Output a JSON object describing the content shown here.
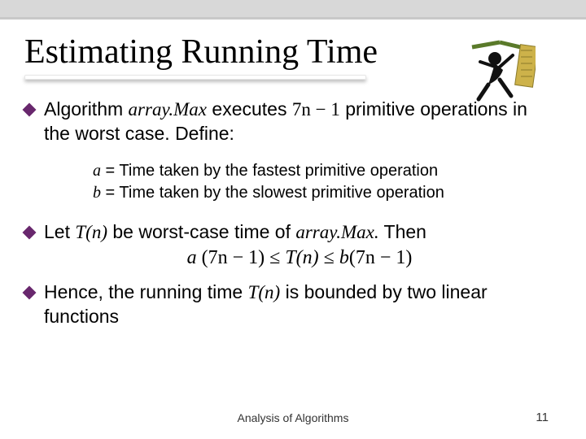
{
  "title": "Estimating Running Time",
  "bullets": {
    "b1": {
      "prefix": "Algorithm ",
      "alg_name": "array.Max",
      "mid1": " executes ",
      "expr": "7n − 1",
      "suffix": " primitive operations in the worst case.  Define:"
    },
    "defs": {
      "a_sym": "a",
      "a_text": " = Time taken by the fastest primitive operation",
      "b_sym": "b",
      "b_text": " = Time taken by the slowest primitive operation"
    },
    "b2": {
      "p1": "Let ",
      "tn": "T(n)",
      "p2": " be worst-case time of ",
      "alg_name": "array.Max.",
      "p3": " Then"
    },
    "ineq": {
      "lhs_a": "a ",
      "lhs_expr": "(7n − 1)",
      "le1": " ≤ ",
      "mid": "T(n)",
      "le2": " ≤ ",
      "rhs_b": "b",
      "rhs_expr": "(7n − 1)"
    },
    "b3": {
      "p1": "Hence, the running time ",
      "tn": "T(n)",
      "p2": " is bounded by two linear functions"
    }
  },
  "footer": {
    "center": "Analysis of Algorithms",
    "page": "11"
  },
  "clipart_name": "running-figure-with-ruler"
}
